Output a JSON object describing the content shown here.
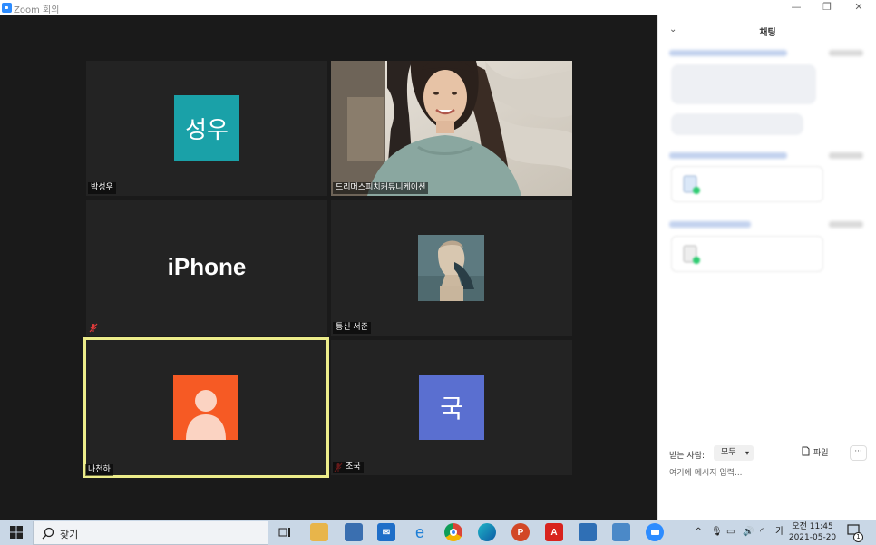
{
  "window": {
    "title": "Zoom 회의",
    "controls": [
      "—",
      "❐",
      "✕"
    ]
  },
  "participants": [
    {
      "name": "박성우",
      "display": "avatar-text",
      "avatar_text": "성우",
      "avatar_color": "#1aa1a8",
      "muted": false,
      "active": false
    },
    {
      "name": "드리머스피치커뮤니케이션",
      "display": "video",
      "muted": false,
      "active": false
    },
    {
      "name": "",
      "display": "big-name",
      "big_name": "iPhone",
      "muted": true,
      "active": false
    },
    {
      "name": "통신 서준",
      "display": "avatar-image",
      "muted": false,
      "active": false
    },
    {
      "name": "나천하",
      "display": "avatar-person",
      "avatar_color": "#f65a24",
      "muted": false,
      "active": true,
      "active_color": "#ecec8a"
    },
    {
      "name": "조국",
      "display": "avatar-text",
      "avatar_text": "국",
      "avatar_color": "#5a6fd0",
      "muted": true,
      "active": false
    }
  ],
  "chat": {
    "title": "채팅",
    "recipient_label": "받는 사람:",
    "recipient_value": "모두",
    "file_label": "파일",
    "more_label": "···",
    "input_placeholder": "여기에 메시지 입력..."
  },
  "taskbar": {
    "search_text": "찾기",
    "pinned_apps": [
      "task-view",
      "file-explorer",
      "store",
      "mail",
      "internet-explorer",
      "chrome",
      "edge",
      "powerpoint",
      "acrobat",
      "photos",
      "kakao",
      "zoom"
    ],
    "ime": "가",
    "clock_time": "오전 11:45",
    "clock_date": "2021-05-20",
    "notification_count": "1"
  },
  "colors": {
    "stage_bg": "#1a1a1a",
    "tile_bg": "#232323",
    "taskbar_bg": "#c9d7e6",
    "accent": "#2d8cff"
  }
}
